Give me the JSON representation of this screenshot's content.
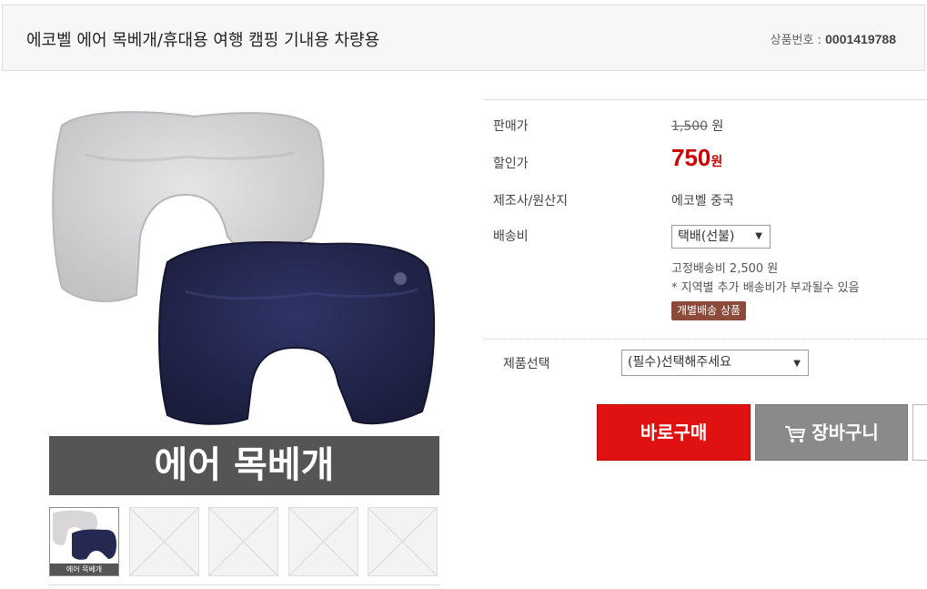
{
  "header": {
    "title": "에코벨 에어 목베개/휴대용 여행 캠핑 기내용 차량용",
    "product_no_label": "상품번호 :",
    "product_no": "0001419788"
  },
  "image": {
    "banner_text": "에어 목베개",
    "thumb_label": "에어 목베개"
  },
  "info": {
    "price_label": "판매가",
    "price_value": "1,500",
    "price_unit": "원",
    "sale_label": "할인가",
    "sale_value": "750",
    "sale_unit": "원",
    "maker_label": "제조사/원산지",
    "maker_value": "에코벨 중국",
    "shipping_label": "배송비",
    "shipping_select": "택배(선불)",
    "shipping_fee": "고정배송비 2,500 원",
    "shipping_note": "* 지역별 추가 배송비가 부과될수 있음",
    "shipping_badge": "개별배송 상품"
  },
  "options": {
    "label": "제품선택",
    "select": "(필수)선택해주세요"
  },
  "buttons": {
    "buy": "바로구매",
    "cart": "장바구니"
  },
  "colors": {
    "buy": "#e01111",
    "cart": "#8a8a8a",
    "sale_price": "#cc0000",
    "badge": "#8b4a3a",
    "pillow_gray": "#d8d6d8",
    "pillow_navy": "#252850"
  }
}
